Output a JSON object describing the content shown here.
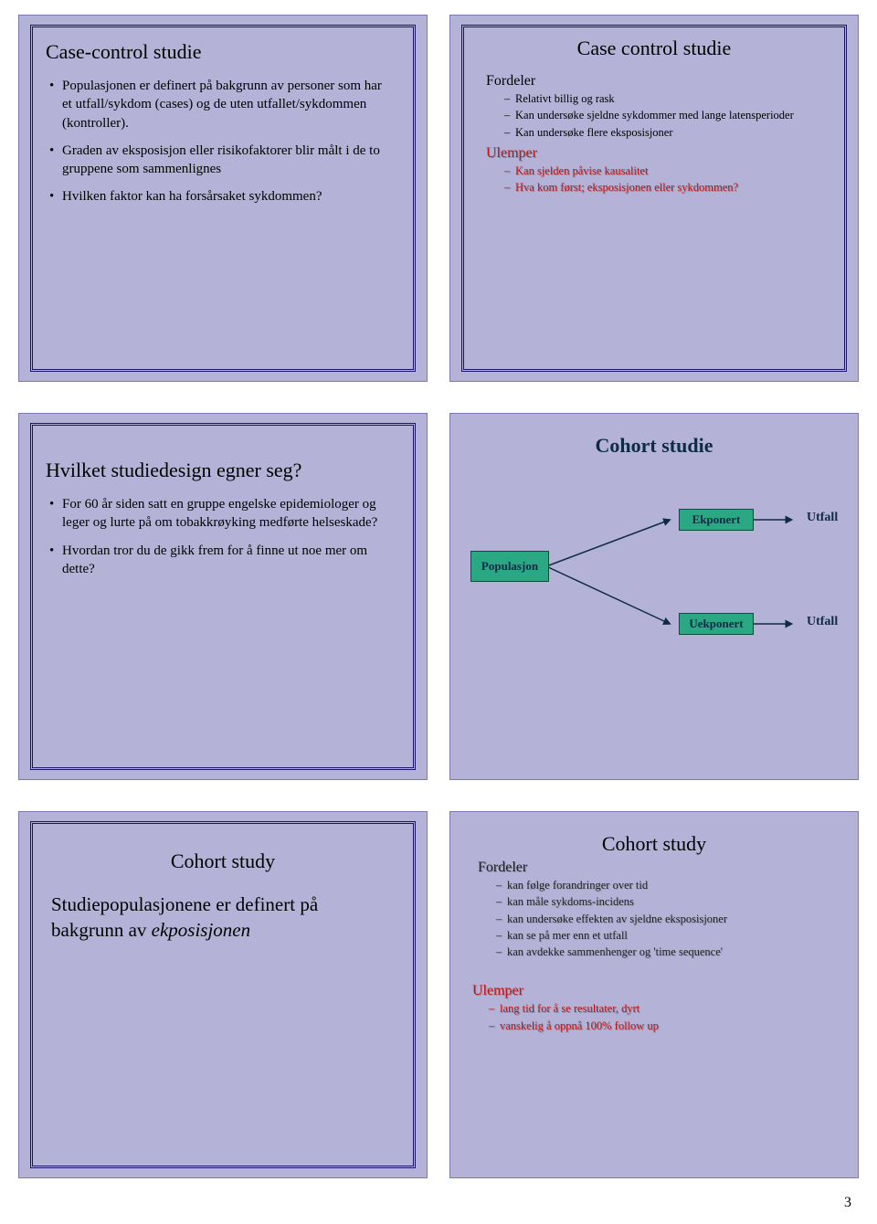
{
  "page_number": "3",
  "slide1": {
    "title": "Case-control studie",
    "b1": "Populasjonen er definert på bakgrunn av personer som har et utfall/sykdom (cases) og de uten utfallet/sykdommen (kontroller).",
    "b2": "Graden av eksposisjon eller risikofaktorer blir målt i de to gruppene som sammenlignes",
    "b3": "Hvilken faktor kan ha forsårsaket sykdommen?"
  },
  "slide2": {
    "title": "Case control studie",
    "fordeler_h": "Fordeler",
    "f1": "Relativt billig og rask",
    "f2": "Kan undersøke sjeldne sykdommer med lange latensperioder",
    "f3": "Kan undersøke flere eksposisjoner",
    "ulemper_h": "Ulemper",
    "u1": "Kan sjelden påvise kausalitet",
    "u2": "Hva kom først; eksposisjonen eller sykdommen?"
  },
  "slide3": {
    "title": "Hvilket studiedesign egner seg?",
    "b1": "For 60 år siden satt en gruppe engelske epidemiologer og leger og lurte på om tobakkrøyking medførte helseskade?",
    "b2": "Hvordan tror du de gikk frem for å finne ut noe mer om dette?"
  },
  "slide4": {
    "title": "Cohort studie",
    "pop": "Populasjon",
    "exp": "Ekponert",
    "uexp": "Uekponert",
    "utfall": "Utfall"
  },
  "slide5": {
    "title": "Cohort study",
    "line1": "Studiepopulasjonene er definert på bakgrunn av ",
    "line1_em": "ekposisjonen"
  },
  "slide6": {
    "title": "Cohort study",
    "fordeler_h": "Fordeler",
    "f1": "kan følge forandringer over tid",
    "f2": "kan måle sykdoms-incidens",
    "f3": "kan undersøke effekten av sjeldne eksposisjoner",
    "f4": "kan se på mer enn et utfall",
    "f5": "kan avdekke sammenhenger og 'time sequence'",
    "ulemper_h": "Ulemper",
    "u1": "lang tid for å se resultater, dyrt",
    "u2": "vanskelig å oppnå 100% follow up"
  }
}
